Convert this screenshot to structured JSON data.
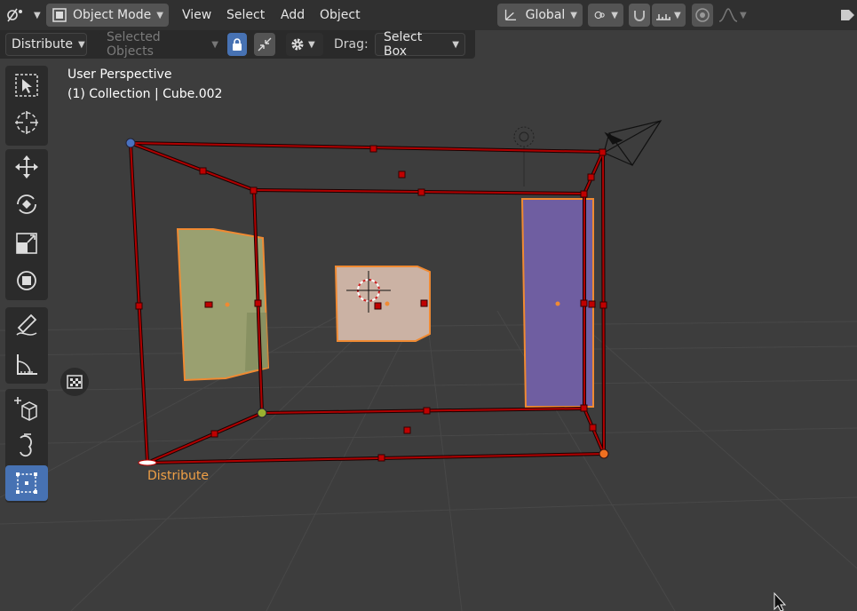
{
  "header": {
    "editor_type_icon": "scene-editor-icon",
    "mode": "Object Mode",
    "menus": [
      "View",
      "Select",
      "Add",
      "Object"
    ],
    "transform_orientation": "Global"
  },
  "tool_settings": {
    "operation": "Distribute",
    "target": "Selected Objects",
    "drag_label": "Drag:",
    "drag_value": "Select Box"
  },
  "viewport": {
    "view_name": "User Perspective",
    "collection_info": "(1) Collection | Cube.002",
    "gizmo_label": "Distribute"
  },
  "colors": {
    "selection_red": "#b00000",
    "active_orange": "#f08a32",
    "panel_green": "#9aa070",
    "panel_peach": "#cbb2a4",
    "panel_purple": "#6f5ea1",
    "accent_blue": "#4772b3"
  }
}
